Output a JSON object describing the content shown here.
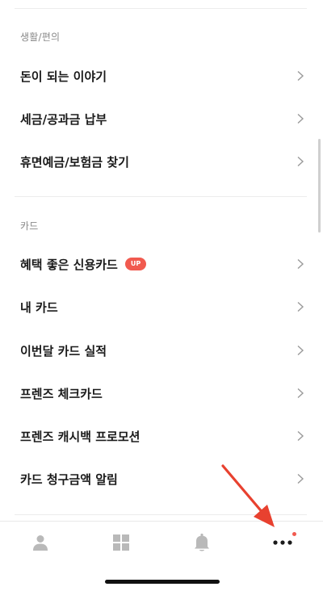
{
  "sections": [
    {
      "header": "생활/편의",
      "items": [
        {
          "label": "돈이 되는 이야기"
        },
        {
          "label": "세금/공과금 납부"
        },
        {
          "label": "휴면예금/보험금 찾기"
        }
      ]
    },
    {
      "header": "카드",
      "items": [
        {
          "label": "혜택 좋은 신용카드",
          "badge": "UP"
        },
        {
          "label": "내 카드"
        },
        {
          "label": "이번달 카드 실적"
        },
        {
          "label": "프렌즈 체크카드"
        },
        {
          "label": "프렌즈 캐시백 프로모션"
        },
        {
          "label": "카드 청구금액 알림"
        }
      ]
    }
  ],
  "tabbar": {
    "tabs": [
      {
        "icon": "person-icon"
      },
      {
        "icon": "grid-icon"
      },
      {
        "icon": "bell-icon"
      },
      {
        "icon": "more-icon",
        "has_notification": true
      }
    ]
  },
  "colors": {
    "accent": "#f15a4f",
    "annotation_arrow": "#e8412f",
    "divider": "#ececec",
    "icon_gray": "#b9b9b9"
  }
}
